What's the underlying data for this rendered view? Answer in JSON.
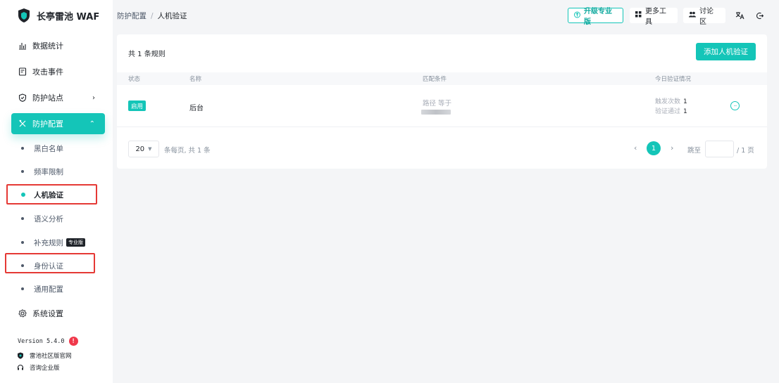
{
  "app": {
    "name": "长亭雷池 WAF"
  },
  "sidebar": {
    "items": [
      {
        "label": "数据统计",
        "icon": "bar-chart-icon"
      },
      {
        "label": "攻击事件",
        "icon": "event-log-icon"
      },
      {
        "label": "防护站点",
        "icon": "shield-outline-icon",
        "chevron": "›"
      },
      {
        "label": "防护配置",
        "icon": "tools-icon",
        "chevron": "⌃",
        "active": true
      }
    ],
    "sub_items": [
      {
        "label": "黑白名单"
      },
      {
        "label": "频率限制"
      },
      {
        "label": "人机验证",
        "active": true
      },
      {
        "label": "语义分析"
      },
      {
        "label": "补充规则",
        "badge": "专业版"
      },
      {
        "label": "身份认证"
      },
      {
        "label": "通用配置"
      }
    ],
    "system": {
      "label": "系统设置",
      "icon": "gear-icon"
    },
    "version": "Version 5.4.0",
    "version_alert": "!",
    "links": [
      {
        "label": "雷池社区版官网",
        "icon": "shield-small-icon"
      },
      {
        "label": "咨询企业版",
        "icon": "headset-icon"
      }
    ]
  },
  "header": {
    "breadcrumb": [
      "防护配置",
      "人机验证"
    ],
    "breadcrumb_sep": "/",
    "upgrade_label": "升级专业版",
    "tools_label": "更多工具",
    "forum_label": "讨论区"
  },
  "main": {
    "rule_count": "共 1 条规则",
    "add_button": "添加人机验证",
    "columns": [
      "状态",
      "名称",
      "匹配条件",
      "今日验证情况"
    ],
    "rows": [
      {
        "status": "启用",
        "name": "后台",
        "condition": "路径 等于",
        "trigger_label": "触发次数",
        "trigger_count": "1",
        "pass_label": "验证通过",
        "pass_count": "1",
        "more": "···"
      }
    ],
    "pagination": {
      "page_size": "20",
      "info": "条每页, 共 1 条",
      "prev": "‹",
      "current_page": "1",
      "next": "›",
      "jump_label": "跳至",
      "jump_value": "",
      "total_pages": "/ 1 页"
    }
  },
  "colors": {
    "accent": "#14c5b8",
    "highlight": "#e53935",
    "alert": "#f0384b"
  }
}
